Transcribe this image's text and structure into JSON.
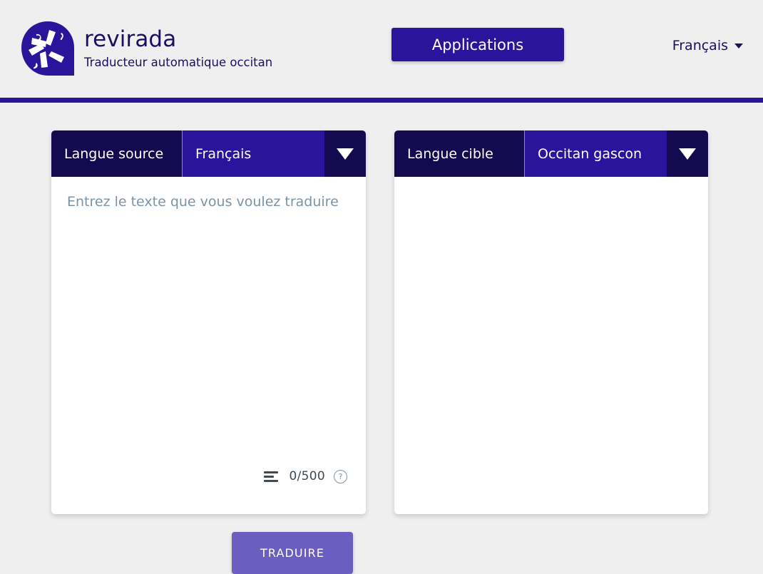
{
  "header": {
    "brand_name": "revirada",
    "tagline": "Traducteur automatique occitan",
    "logo_icon": "revirada-flower-logo-icon",
    "applications_label": "Applications",
    "interface_language": "Français",
    "language_caret_icon": "chevron-down-icon"
  },
  "source_panel": {
    "lang_label": "Langue source",
    "selected_language": "Français",
    "dropdown_icon": "triangle-down-icon",
    "input_value": "",
    "input_placeholder": "Entrez le texte que vous voulez traduire",
    "lines_icon": "text-lines-icon",
    "char_counter": "0/500",
    "help_icon": "question-circle-icon",
    "translate_label": "TRADUIRE"
  },
  "target_panel": {
    "lang_label": "Langue cible",
    "selected_language": "Occitan gascon",
    "dropdown_icon": "triangle-down-icon",
    "output_value": ""
  },
  "colors": {
    "page_background": "#efefef",
    "brand_indigo": "#2a149b",
    "deep_navy": "#140a50",
    "translate_purple": "#6b5ec0",
    "placeholder_gray": "#7b93a8",
    "panel_white": "#ffffff"
  }
}
